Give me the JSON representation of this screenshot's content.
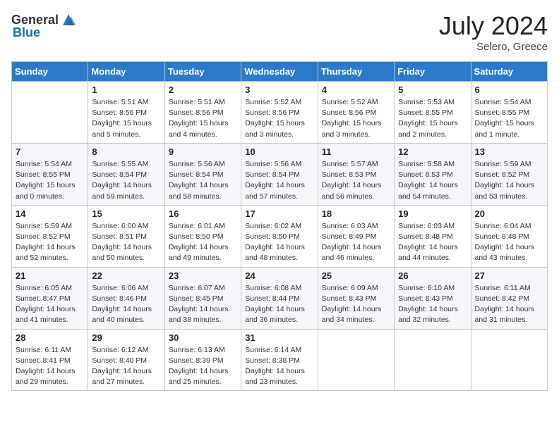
{
  "header": {
    "logo_general": "General",
    "logo_blue": "Blue",
    "month_year": "July 2024",
    "location": "Selero, Greece"
  },
  "days_of_week": [
    "Sunday",
    "Monday",
    "Tuesday",
    "Wednesday",
    "Thursday",
    "Friday",
    "Saturday"
  ],
  "weeks": [
    [
      {
        "day": "",
        "info": ""
      },
      {
        "day": "1",
        "info": "Sunrise: 5:51 AM\nSunset: 8:56 PM\nDaylight: 15 hours\nand 5 minutes."
      },
      {
        "day": "2",
        "info": "Sunrise: 5:51 AM\nSunset: 8:56 PM\nDaylight: 15 hours\nand 4 minutes."
      },
      {
        "day": "3",
        "info": "Sunrise: 5:52 AM\nSunset: 8:56 PM\nDaylight: 15 hours\nand 3 minutes."
      },
      {
        "day": "4",
        "info": "Sunrise: 5:52 AM\nSunset: 8:56 PM\nDaylight: 15 hours\nand 3 minutes."
      },
      {
        "day": "5",
        "info": "Sunrise: 5:53 AM\nSunset: 8:55 PM\nDaylight: 15 hours\nand 2 minutes."
      },
      {
        "day": "6",
        "info": "Sunrise: 5:54 AM\nSunset: 8:55 PM\nDaylight: 15 hours\nand 1 minute."
      }
    ],
    [
      {
        "day": "7",
        "info": "Sunrise: 5:54 AM\nSunset: 8:55 PM\nDaylight: 15 hours\nand 0 minutes."
      },
      {
        "day": "8",
        "info": "Sunrise: 5:55 AM\nSunset: 8:54 PM\nDaylight: 14 hours\nand 59 minutes."
      },
      {
        "day": "9",
        "info": "Sunrise: 5:56 AM\nSunset: 8:54 PM\nDaylight: 14 hours\nand 58 minutes."
      },
      {
        "day": "10",
        "info": "Sunrise: 5:56 AM\nSunset: 8:54 PM\nDaylight: 14 hours\nand 57 minutes."
      },
      {
        "day": "11",
        "info": "Sunrise: 5:57 AM\nSunset: 8:53 PM\nDaylight: 14 hours\nand 56 minutes."
      },
      {
        "day": "12",
        "info": "Sunrise: 5:58 AM\nSunset: 8:53 PM\nDaylight: 14 hours\nand 54 minutes."
      },
      {
        "day": "13",
        "info": "Sunrise: 5:59 AM\nSunset: 8:52 PM\nDaylight: 14 hours\nand 53 minutes."
      }
    ],
    [
      {
        "day": "14",
        "info": "Sunrise: 5:59 AM\nSunset: 8:52 PM\nDaylight: 14 hours\nand 52 minutes."
      },
      {
        "day": "15",
        "info": "Sunrise: 6:00 AM\nSunset: 8:51 PM\nDaylight: 14 hours\nand 50 minutes."
      },
      {
        "day": "16",
        "info": "Sunrise: 6:01 AM\nSunset: 8:50 PM\nDaylight: 14 hours\nand 49 minutes."
      },
      {
        "day": "17",
        "info": "Sunrise: 6:02 AM\nSunset: 8:50 PM\nDaylight: 14 hours\nand 48 minutes."
      },
      {
        "day": "18",
        "info": "Sunrise: 6:03 AM\nSunset: 8:49 PM\nDaylight: 14 hours\nand 46 minutes."
      },
      {
        "day": "19",
        "info": "Sunrise: 6:03 AM\nSunset: 8:48 PM\nDaylight: 14 hours\nand 44 minutes."
      },
      {
        "day": "20",
        "info": "Sunrise: 6:04 AM\nSunset: 8:48 PM\nDaylight: 14 hours\nand 43 minutes."
      }
    ],
    [
      {
        "day": "21",
        "info": "Sunrise: 6:05 AM\nSunset: 8:47 PM\nDaylight: 14 hours\nand 41 minutes."
      },
      {
        "day": "22",
        "info": "Sunrise: 6:06 AM\nSunset: 8:46 PM\nDaylight: 14 hours\nand 40 minutes."
      },
      {
        "day": "23",
        "info": "Sunrise: 6:07 AM\nSunset: 8:45 PM\nDaylight: 14 hours\nand 38 minutes."
      },
      {
        "day": "24",
        "info": "Sunrise: 6:08 AM\nSunset: 8:44 PM\nDaylight: 14 hours\nand 36 minutes."
      },
      {
        "day": "25",
        "info": "Sunrise: 6:09 AM\nSunset: 8:43 PM\nDaylight: 14 hours\nand 34 minutes."
      },
      {
        "day": "26",
        "info": "Sunrise: 6:10 AM\nSunset: 8:43 PM\nDaylight: 14 hours\nand 32 minutes."
      },
      {
        "day": "27",
        "info": "Sunrise: 6:11 AM\nSunset: 8:42 PM\nDaylight: 14 hours\nand 31 minutes."
      }
    ],
    [
      {
        "day": "28",
        "info": "Sunrise: 6:11 AM\nSunset: 8:41 PM\nDaylight: 14 hours\nand 29 minutes."
      },
      {
        "day": "29",
        "info": "Sunrise: 6:12 AM\nSunset: 8:40 PM\nDaylight: 14 hours\nand 27 minutes."
      },
      {
        "day": "30",
        "info": "Sunrise: 6:13 AM\nSunset: 8:39 PM\nDaylight: 14 hours\nand 25 minutes."
      },
      {
        "day": "31",
        "info": "Sunrise: 6:14 AM\nSunset: 8:38 PM\nDaylight: 14 hours\nand 23 minutes."
      },
      {
        "day": "",
        "info": ""
      },
      {
        "day": "",
        "info": ""
      },
      {
        "day": "",
        "info": ""
      }
    ]
  ]
}
